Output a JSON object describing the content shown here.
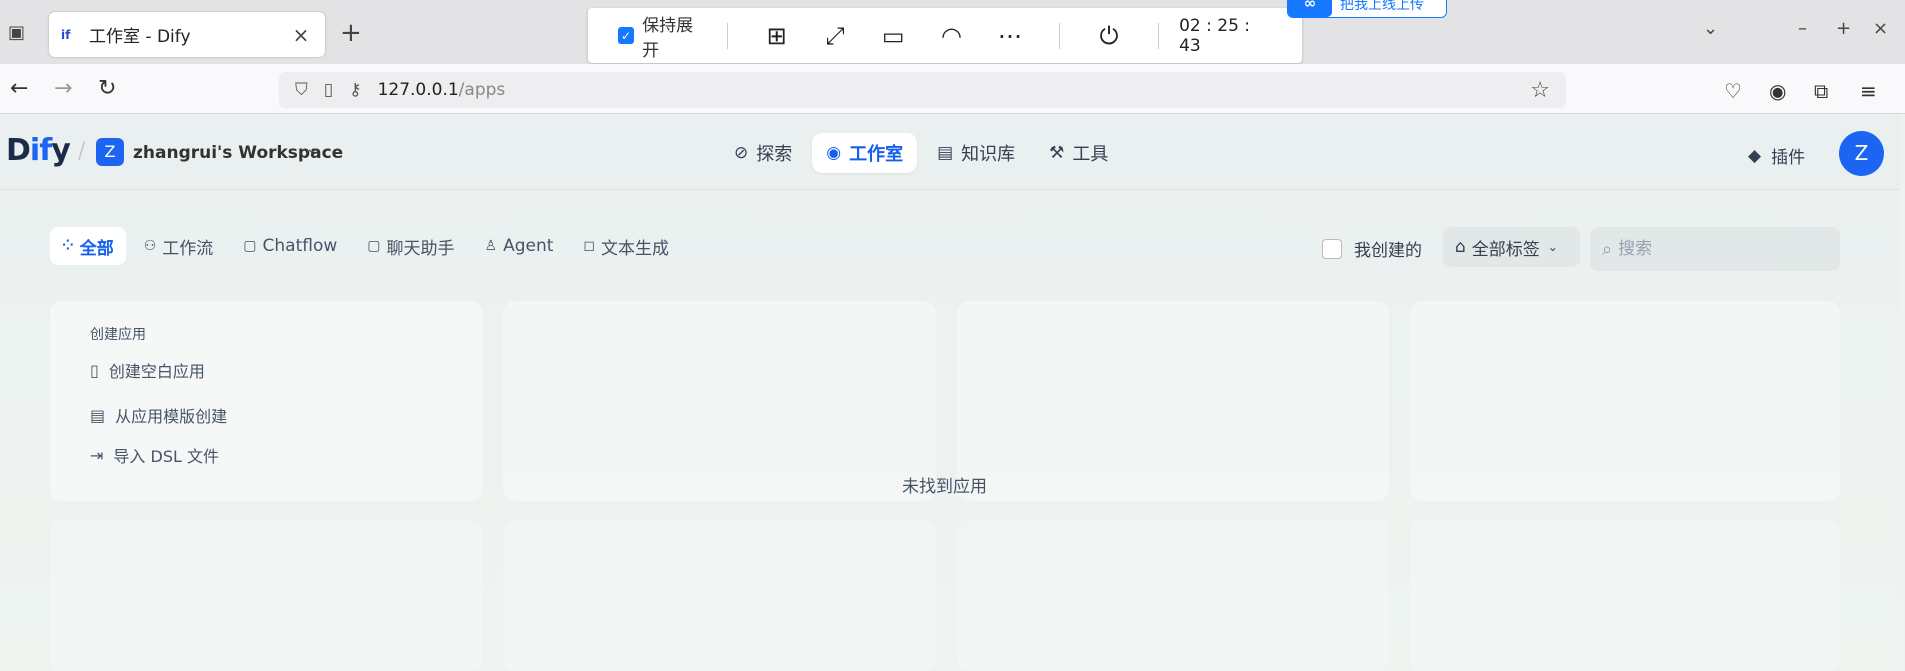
{
  "browser": {
    "tab_title": "工作室 - Dify",
    "tab_favicon": "if",
    "new_tab": "+",
    "url_host": "127.0.0.1",
    "url_path": "/apps"
  },
  "remote": {
    "keep_expanded": "保持展开",
    "timer": "02 : 25 : 43",
    "badge": "把我上线上传"
  },
  "header": {
    "logo_d": "D",
    "logo_i": "if",
    "logo_y": "y",
    "workspace_initial": "Z",
    "workspace_name": "zhangrui's Workspace",
    "user_initial": "Z",
    "plugin": "插件"
  },
  "nav": {
    "explore": "探索",
    "studio": "工作室",
    "knowledge": "知识库",
    "tools": "工具"
  },
  "filters": {
    "all": "全部",
    "workflow": "工作流",
    "chatflow": "Chatflow",
    "chat": "聊天助手",
    "agent": "Agent",
    "text": "文本生成"
  },
  "toolbar": {
    "mine": "我创建的",
    "tags": "全部标签",
    "search_placeholder": "搜索"
  },
  "create": {
    "title": "创建应用",
    "blank": "创建空白应用",
    "template": "从应用模版创建",
    "import": "导入 DSL 文件"
  },
  "empty_text": "未找到应用",
  "colors": {
    "accent": "#155eef",
    "brand": "#1c64f2",
    "remote_blue": "#1677ff"
  }
}
